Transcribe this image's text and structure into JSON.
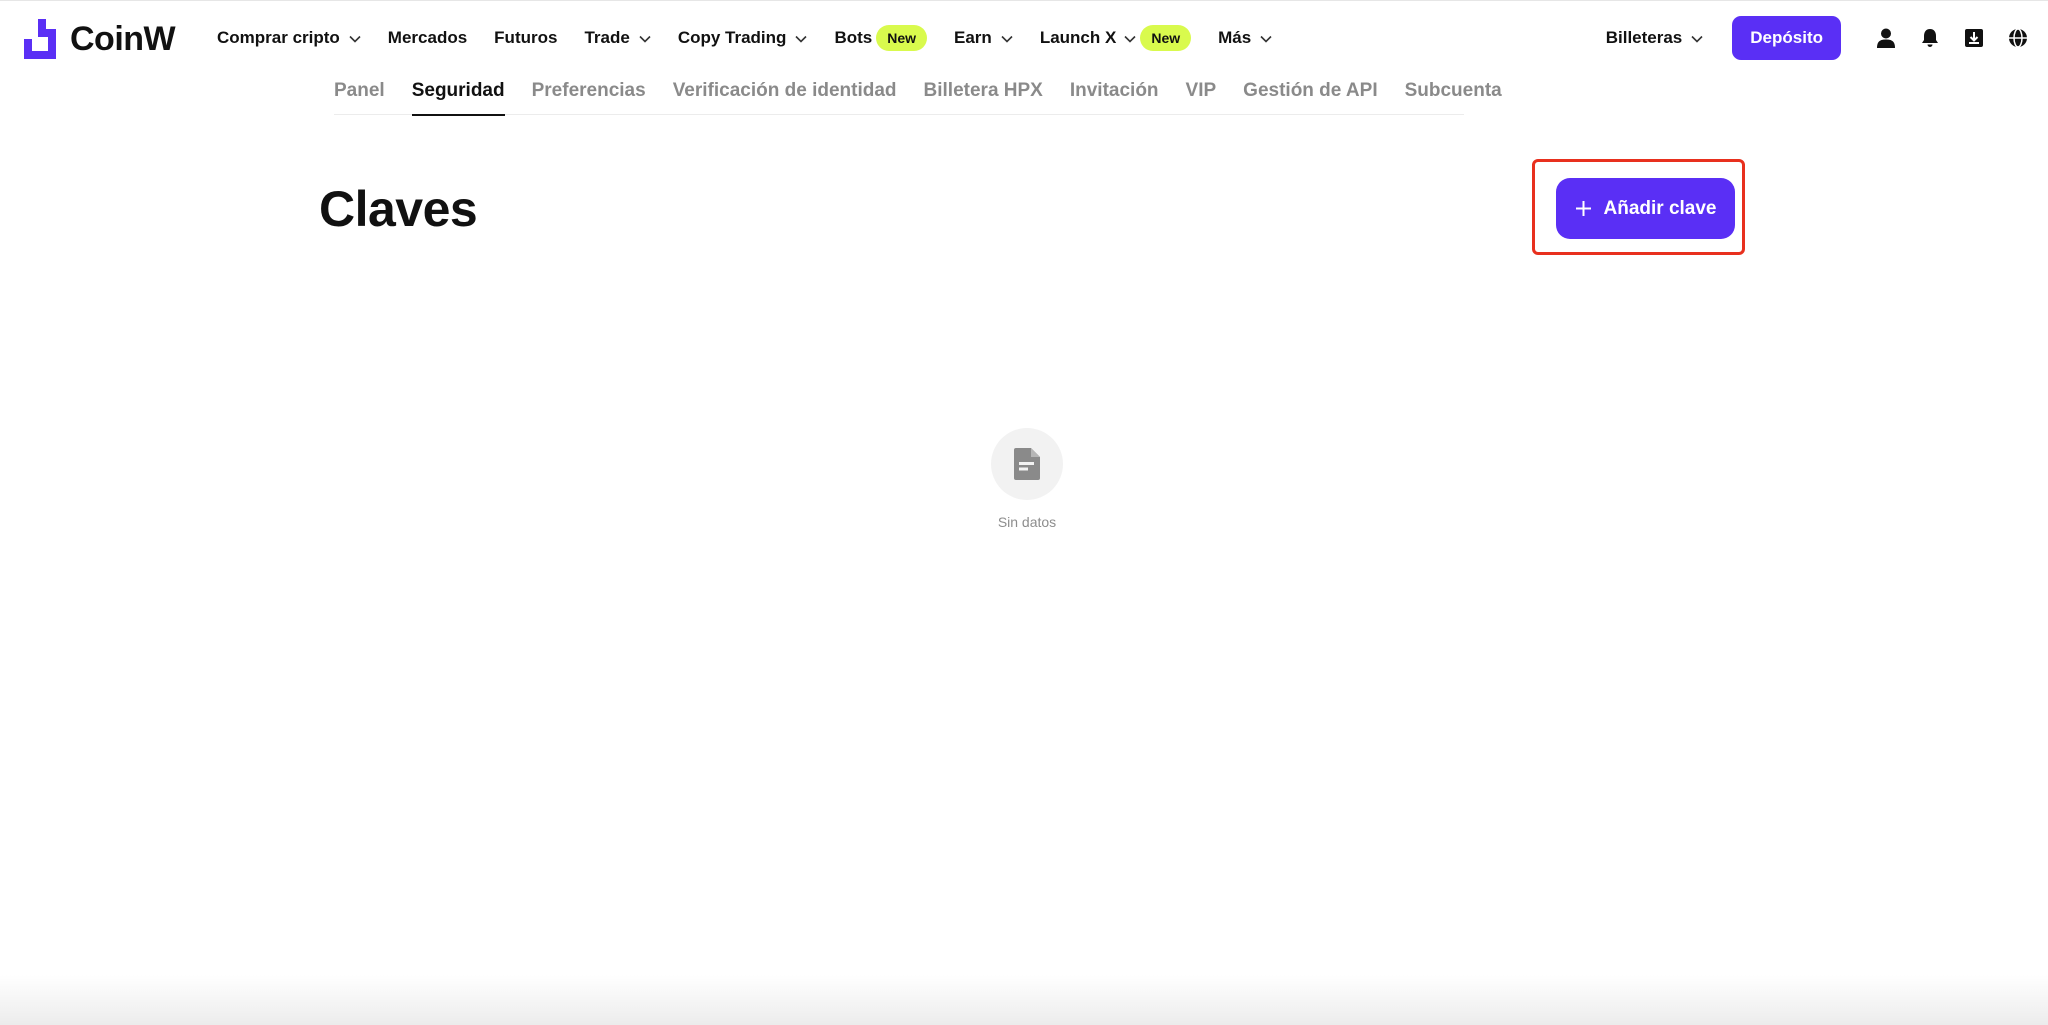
{
  "brand": {
    "name": "CoinW",
    "accent_color": "#5a2ff5"
  },
  "nav": {
    "items": [
      {
        "label": "Comprar cripto",
        "has_dropdown": true
      },
      {
        "label": "Mercados",
        "has_dropdown": false
      },
      {
        "label": "Futuros",
        "has_dropdown": false
      },
      {
        "label": "Trade",
        "has_dropdown": true
      },
      {
        "label": "Copy Trading",
        "has_dropdown": true
      },
      {
        "label": "Bots",
        "badge": "New",
        "has_dropdown": false
      },
      {
        "label": "Earn",
        "has_dropdown": true
      },
      {
        "label": "Launch X",
        "badge": "New",
        "has_dropdown": true
      },
      {
        "label": "Más",
        "has_dropdown": true
      }
    ],
    "badge_color": "#d9fa4d",
    "wallets_label": "Billeteras",
    "deposit_label": "Depósito",
    "icons": [
      "user-icon",
      "bell-icon",
      "download-icon",
      "globe-icon"
    ]
  },
  "subtabs": {
    "items": [
      "Panel",
      "Seguridad",
      "Preferencias",
      "Verificación de identidad",
      "Billetera HPX",
      "Invitación",
      "VIP",
      "Gestión de API",
      "Subcuenta"
    ],
    "active": "Seguridad"
  },
  "main": {
    "title": "Claves",
    "add_button_label": "Añadir clave",
    "highlight_color": "#e8301e",
    "empty_text": "Sin datos"
  }
}
